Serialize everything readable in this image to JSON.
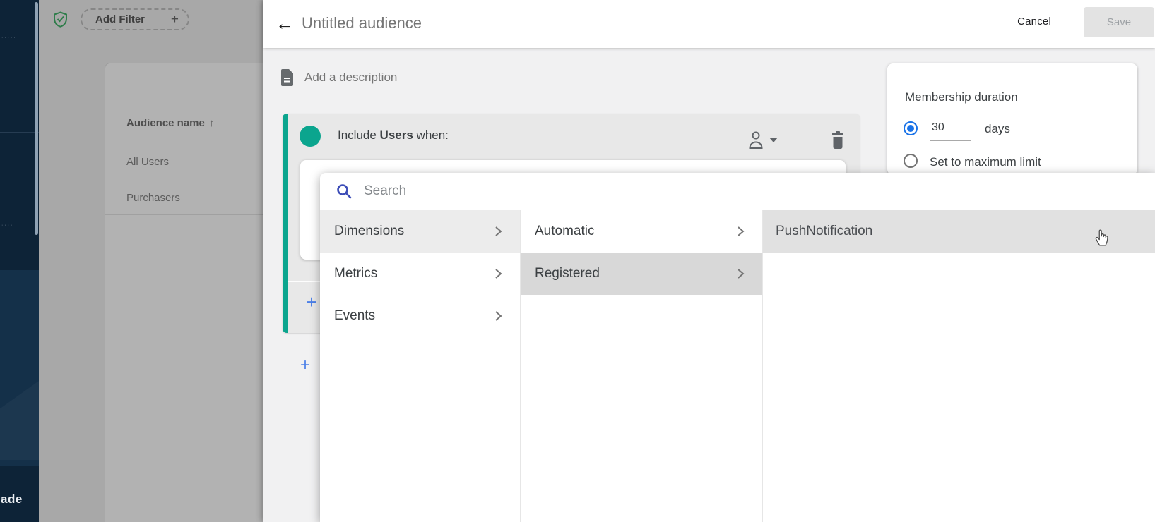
{
  "sidebar": {
    "upgrade_text_partial": "ade",
    "fragment1": "·····",
    "fragment2": "····"
  },
  "backdrop": {
    "add_filter_label": "Add Filter",
    "add_filter_plus": "+",
    "audience_table": {
      "header": "Audience name",
      "sort_arrow": "↑",
      "rows": [
        "All Users",
        "Purchasers"
      ]
    }
  },
  "header": {
    "back_arrow": "←",
    "title": "Untitled audience",
    "cancel_label": "Cancel",
    "save_label": "Save"
  },
  "description": {
    "label": "Add a description"
  },
  "include_card": {
    "prefix": "Include ",
    "subject": "Users",
    "suffix": " when:",
    "add_condition_plus": "+",
    "add_group_plus": "+"
  },
  "dropdown": {
    "search_placeholder": "Search",
    "column1": [
      "Dimensions",
      "Metrics",
      "Events"
    ],
    "column2": [
      "Automatic",
      "Registered"
    ],
    "column3": [
      "PushNotification"
    ]
  },
  "membership": {
    "title": "Membership duration",
    "duration_value": "30",
    "duration_unit": "days",
    "max_limit_label": "Set to maximum limit"
  },
  "colors": {
    "accent_teal": "#0ba58e",
    "radio_blue": "#1a73e8",
    "plus_blue": "#4c80e8",
    "search_icon_blue": "#3d4db7"
  }
}
